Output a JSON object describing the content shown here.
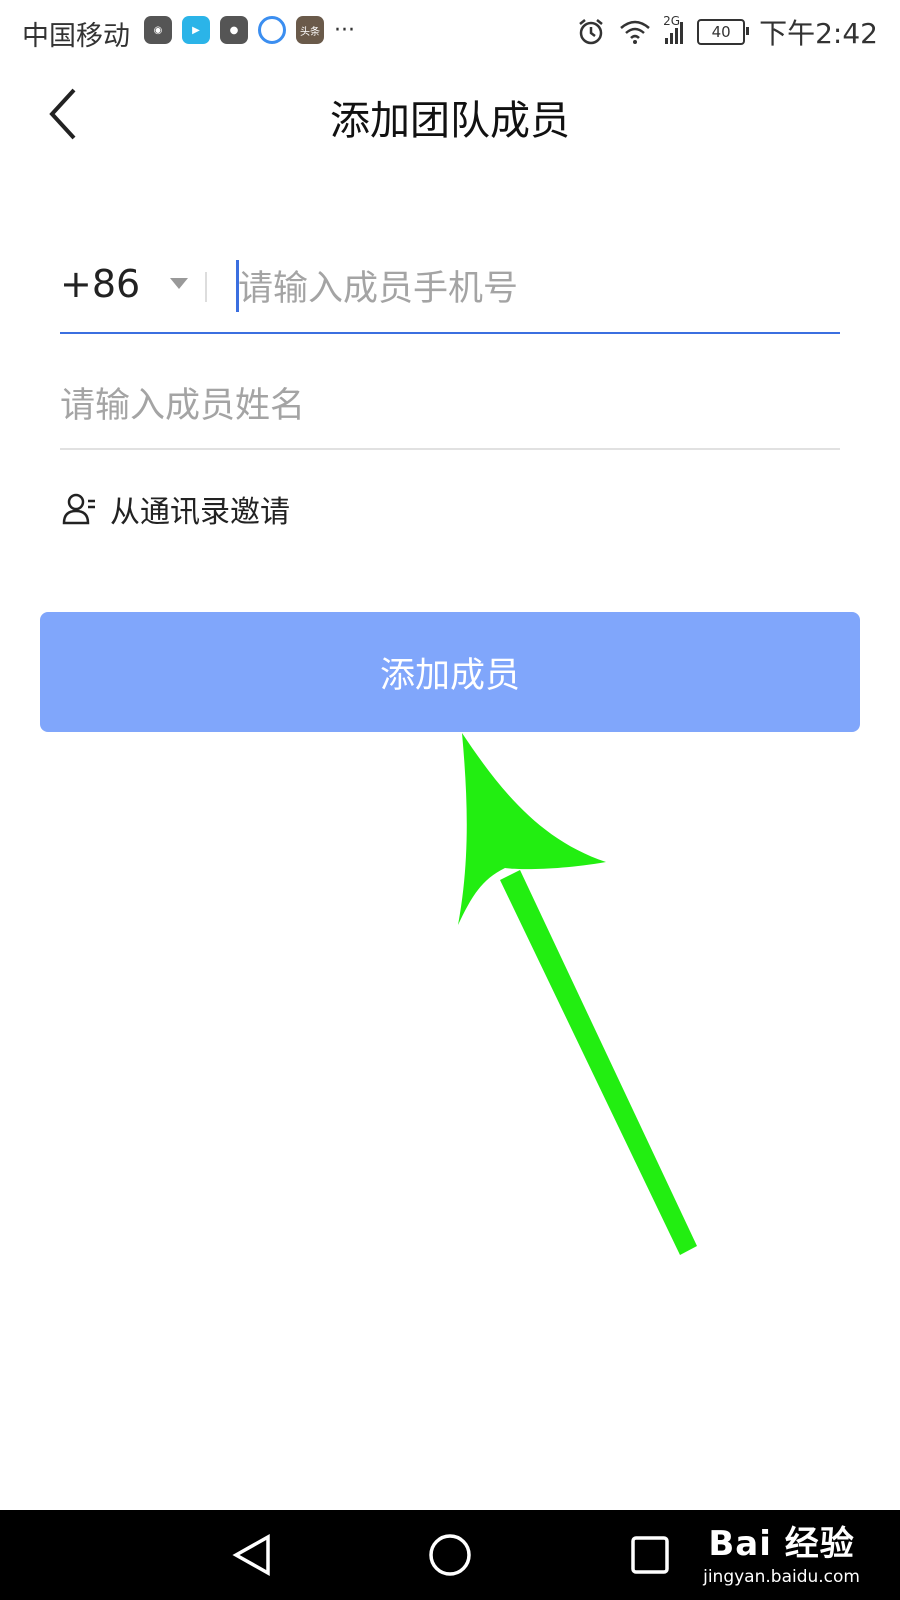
{
  "status_bar": {
    "carrier": "中国移动",
    "app_icons": [
      "camera-app-icon",
      "video-app-icon",
      "recorder-app-icon",
      "browser-app-icon",
      "news-app-icon"
    ],
    "news_icon_text": "头条",
    "more": "···",
    "network": "2G",
    "battery": "40",
    "time": "下午2:42"
  },
  "header": {
    "title": "添加团队成员"
  },
  "form": {
    "country_code": "+86",
    "phone_placeholder": "请输入成员手机号",
    "name_placeholder": "请输入成员姓名",
    "invite_label": "从通讯录邀请",
    "add_button_label": "添加成员"
  },
  "colors": {
    "accent": "#3b6fe0",
    "button_bg": "#80a6fb",
    "arrow": "#22ee11"
  },
  "nav_bar": {
    "items": [
      "back-nav-icon",
      "home-nav-icon",
      "recents-nav-icon"
    ]
  },
  "watermark": {
    "logo": "Bai 经验",
    "url": "jingyan.baidu.com"
  }
}
